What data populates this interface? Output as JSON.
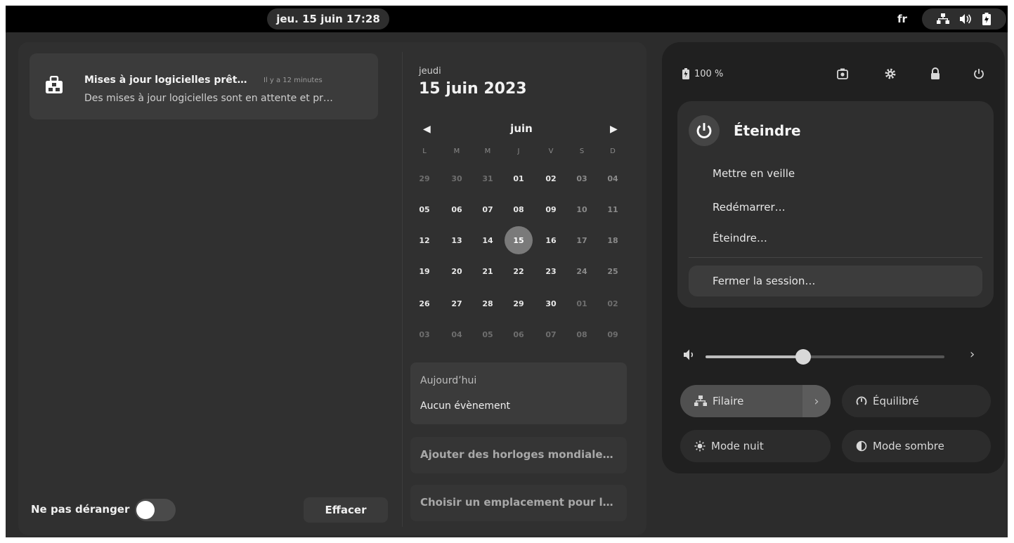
{
  "topbar": {
    "clock": "jeu. 15 juin  17:28",
    "language": "fr",
    "status_icons": [
      "network-wired-icon",
      "volume-icon",
      "battery-icon"
    ]
  },
  "notifications": {
    "items": [
      {
        "icon": "software-bag-icon",
        "title": "Mises à jour logicielles prêt…",
        "time": "Il y a 12 minutes",
        "body": "Des mises à jour logicielles sont en attente et pr…"
      }
    ],
    "dnd_label": "Ne pas déranger",
    "dnd_on": false,
    "clear_label": "Effacer"
  },
  "calendar": {
    "weekday": "jeudi",
    "full_date": "15 juin 2023",
    "month": "juin",
    "day_headers": [
      "L",
      "M",
      "M",
      "J",
      "V",
      "S",
      "D"
    ],
    "weeks": [
      [
        "29",
        "30",
        "31",
        "01",
        "02",
        "03",
        "04"
      ],
      [
        "05",
        "06",
        "07",
        "08",
        "09",
        "10",
        "11"
      ],
      [
        "12",
        "13",
        "14",
        "15",
        "16",
        "17",
        "18"
      ],
      [
        "19",
        "20",
        "21",
        "22",
        "23",
        "24",
        "25"
      ],
      [
        "26",
        "27",
        "28",
        "29",
        "30",
        "01",
        "02"
      ],
      [
        "03",
        "04",
        "05",
        "06",
        "07",
        "08",
        "09"
      ]
    ],
    "today": "15",
    "events_title": "Aujourd’hui",
    "events_text": "Aucun évènement",
    "world_clocks_label": "Ajouter des horloges mondiale…",
    "weather_label": "Choisir un emplacement pour l…"
  },
  "quick_settings": {
    "battery": "100 %",
    "top_icons": [
      "screenshot-icon",
      "settings-icon",
      "lock-icon",
      "power-icon"
    ],
    "power_menu": {
      "title": "Éteindre",
      "items": [
        "Mettre en veille",
        "Redémarrer…",
        "Éteindre…"
      ],
      "logout": "Fermer la session…"
    },
    "volume_level": 0.41,
    "buttons": {
      "wired": "Filaire",
      "power_profile": "Équilibré",
      "night": "Mode nuit",
      "dark": "Mode sombre"
    }
  }
}
